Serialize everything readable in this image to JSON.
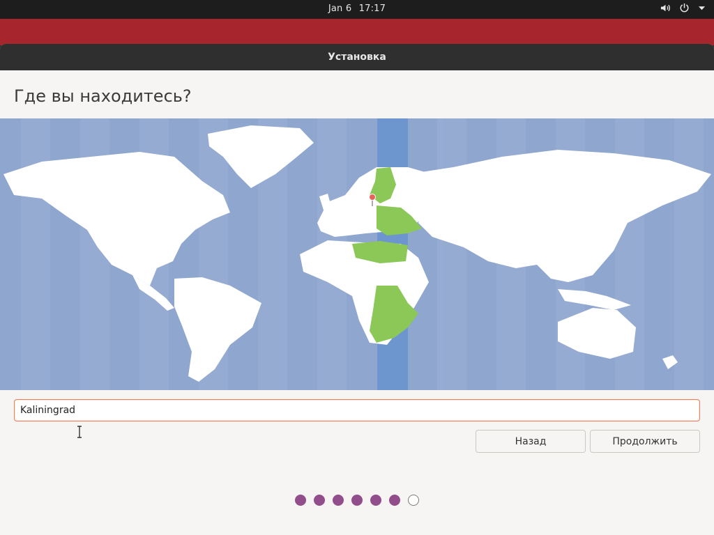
{
  "topbar": {
    "date": "Jan 6",
    "time": "17:17",
    "icons": [
      "volume-icon",
      "power-icon",
      "chevron-down-icon"
    ]
  },
  "window": {
    "title": "Установка"
  },
  "page": {
    "heading": "Где вы находитесь?"
  },
  "location": {
    "value": "Kaliningrad"
  },
  "buttons": {
    "back": "Назад",
    "next": "Продолжить"
  },
  "progress": {
    "total": 7,
    "completed": 6
  },
  "colors": {
    "accent": "#e95420",
    "desktop": "#a7262e",
    "ocean": "#8fa6cf",
    "selected_zone": "#6d96cf",
    "zone_highlight": "#8bc858",
    "progress_dot": "#924d8b",
    "pin": "#e9625b"
  }
}
